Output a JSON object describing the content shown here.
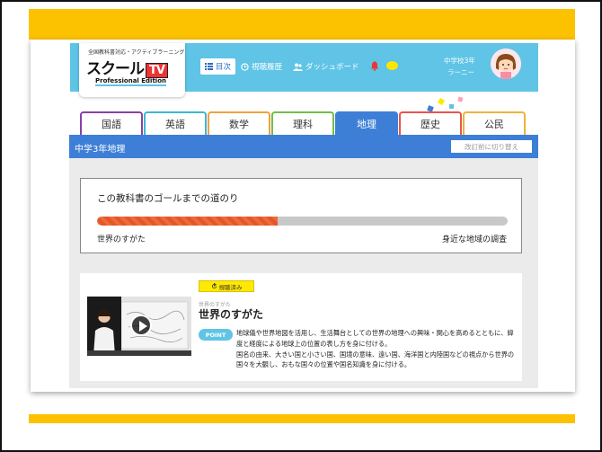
{
  "colors": {
    "accent_yellow": "#fcc200",
    "header_blue": "#5fc4e6",
    "subject_blue": "#3d7fd6",
    "progress_orange": "#f06a36"
  },
  "logo": {
    "subtitle": "全国教科書対応・アクティブラーニング",
    "main": "スクール",
    "tv": "TV",
    "edition": "Professional Edition"
  },
  "header": {
    "nav": [
      {
        "label": "目次",
        "icon": "list-icon"
      },
      {
        "label": "視聴履歴",
        "icon": "history-icon"
      },
      {
        "label": "ダッシュボード",
        "icon": "users-icon"
      }
    ],
    "user": {
      "grade": "中学校3年",
      "name": "ラーニー"
    }
  },
  "tabs": [
    {
      "label": "国語",
      "color": "#8b3fa8"
    },
    {
      "label": "英語",
      "color": "#3fb6d6"
    },
    {
      "label": "数学",
      "color": "#f0a33a"
    },
    {
      "label": "理科",
      "color": "#6fbf4a"
    },
    {
      "label": "地理",
      "color": "#3d7fd6"
    },
    {
      "label": "歴史",
      "color": "#e8564a"
    },
    {
      "label": "公民",
      "color": "#f0b23a"
    }
  ],
  "subject": {
    "title": "中学3年地理",
    "revise_label": "改訂前に切り替え"
  },
  "goal": {
    "title": "この教科書のゴールまでの道のり",
    "progress": 0.44,
    "start_label": "世界のすがた",
    "end_label": "身近な地域の調査"
  },
  "lesson": {
    "watched_label": "視聴済み",
    "kicker": "世界のすがた",
    "title": "世界のすがた",
    "point_label": "POINT",
    "description_1": "地球儀や世界地図を活用し、生活舞台としての世界の地理への興味・関心を高めるとともに、緯度と経度による地球上の位置の表し方を身に付ける。",
    "description_2": "国名の由来、大きい国と小さい国、国境の意味、遠い国、海洋国と内陸国などの視点から世界の国々を大観し、おもな国々の位置や国名知識を身に付ける。"
  }
}
